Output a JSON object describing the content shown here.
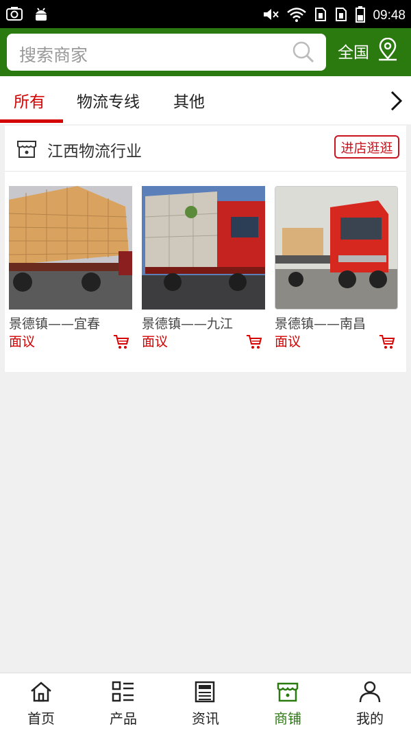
{
  "status_bar": {
    "time": "09:48"
  },
  "header": {
    "search_placeholder": "搜索商家",
    "region": "全国"
  },
  "tabs": [
    {
      "label": "所有"
    },
    {
      "label": "物流专线"
    },
    {
      "label": "其他"
    }
  ],
  "shop": {
    "name": "江西物流行业",
    "visit_button": "进店逛逛",
    "products": [
      {
        "title": "景德镇——宜春",
        "price": "面议"
      },
      {
        "title": "景德镇——九江",
        "price": "面议"
      },
      {
        "title": "景德镇——南昌",
        "price": "面议"
      }
    ]
  },
  "bottom_nav": [
    {
      "label": "首页",
      "icon": "home-icon"
    },
    {
      "label": "产品",
      "icon": "list-icon"
    },
    {
      "label": "资讯",
      "icon": "news-icon"
    },
    {
      "label": "商铺",
      "icon": "shop-icon"
    },
    {
      "label": "我的",
      "icon": "user-icon"
    }
  ],
  "colors": {
    "brand_green": "#2b7a10",
    "accent_red": "#d40000"
  }
}
